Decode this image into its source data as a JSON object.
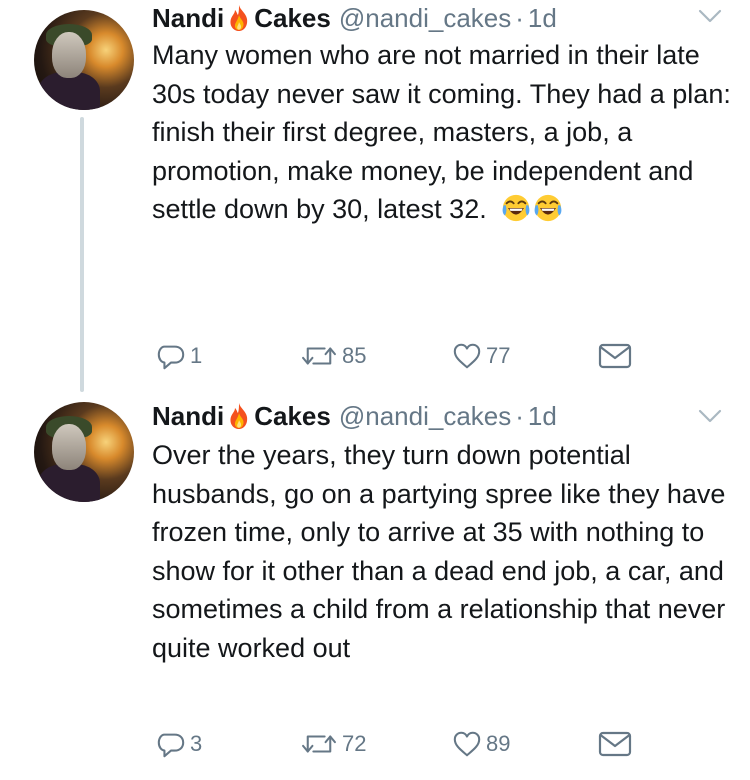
{
  "tweets": [
    {
      "author": {
        "name_part1": "Nandi",
        "name_part2": "Cakes",
        "name_emoji": "fire-icon",
        "handle": "@nandi_cakes",
        "time": "1d"
      },
      "text": "Many women who are not married in their late 30s today never saw it coming. They had a plan: finish their first degree, masters, a job, a promotion, make money, be independent and settle down by 30, latest 32.",
      "trailing_emoji": [
        "face-with-tears-of-joy-icon",
        "face-with-tears-of-joy-icon"
      ],
      "actions": {
        "replies": "1",
        "retweets": "85",
        "likes": "77"
      }
    },
    {
      "author": {
        "name_part1": "Nandi",
        "name_part2": "Cakes",
        "name_emoji": "fire-icon",
        "handle": "@nandi_cakes",
        "time": "1d"
      },
      "text": "Over the years, they turn down potential husbands, go on a partying spree like they have frozen time, only to arrive at 35 with nothing to show for it other than a dead end job, a car, and sometimes a child from a relationship that never quite worked out",
      "trailing_emoji": [],
      "actions": {
        "replies": "3",
        "retweets": "72",
        "likes": "89"
      }
    }
  ],
  "ui": {
    "separator": "·"
  },
  "colors": {
    "text": "#14171a",
    "secondary": "#657786",
    "thread_line": "#cfd9de",
    "background": "#ffffff"
  }
}
